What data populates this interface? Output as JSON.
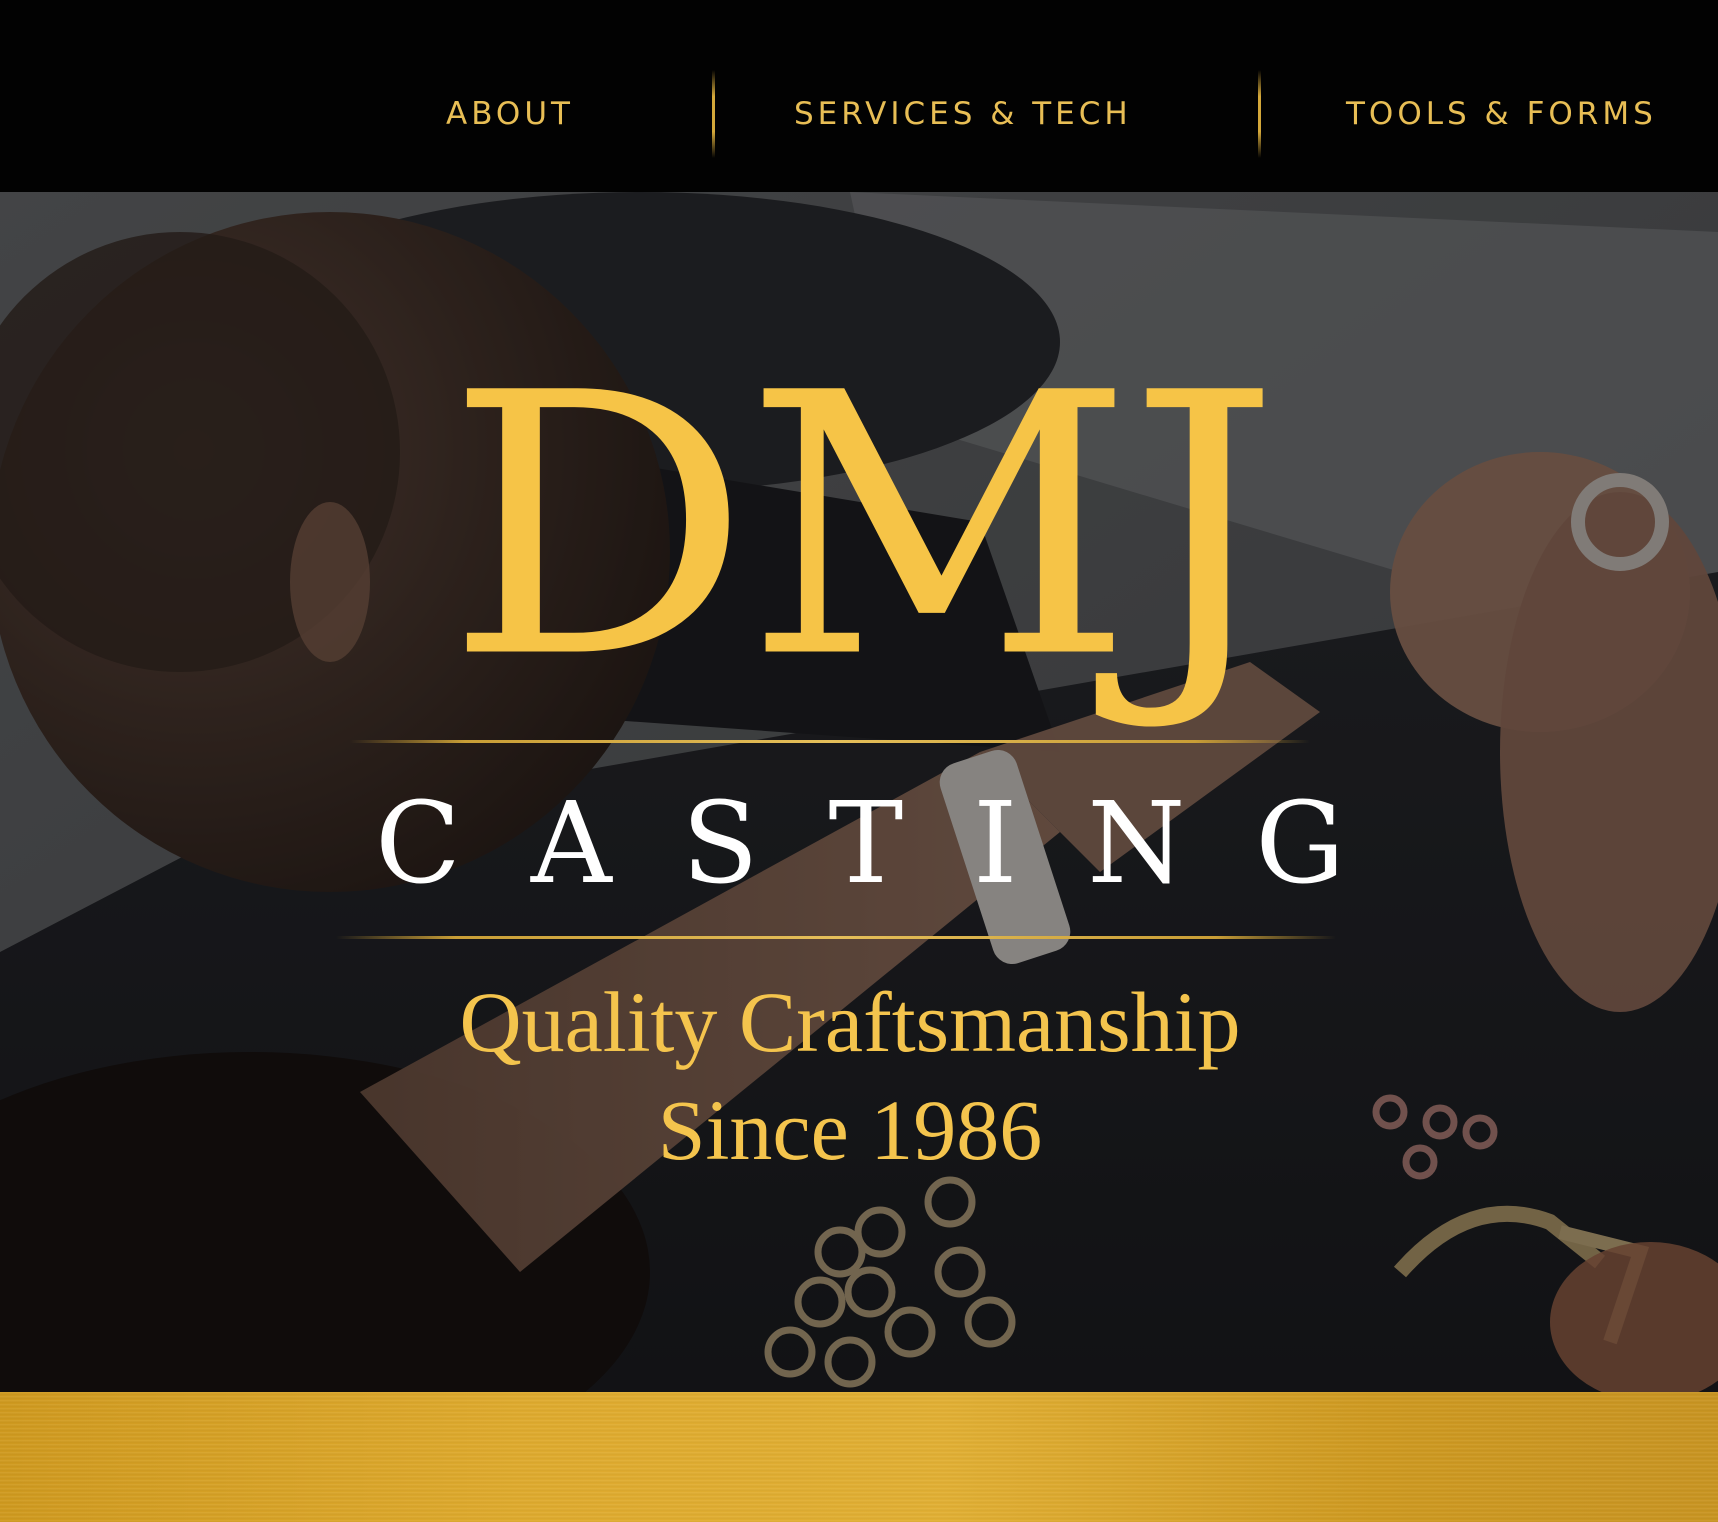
{
  "nav": {
    "items": [
      {
        "label": "ABOUT"
      },
      {
        "label": "SERVICES & TECH"
      },
      {
        "label": "TOOLS & FORMS"
      }
    ]
  },
  "hero": {
    "logo_main": "DMJ",
    "logo_sub": "CASTING",
    "tagline_line1": "Quality Craftsmanship",
    "tagline_line2": "Since 1986"
  },
  "colors": {
    "nav_background": "#020202",
    "nav_text": "#e8be55",
    "logo_gold": "#f6c447",
    "logo_white": "#ffffff",
    "band_gold": "#dfab2e"
  }
}
